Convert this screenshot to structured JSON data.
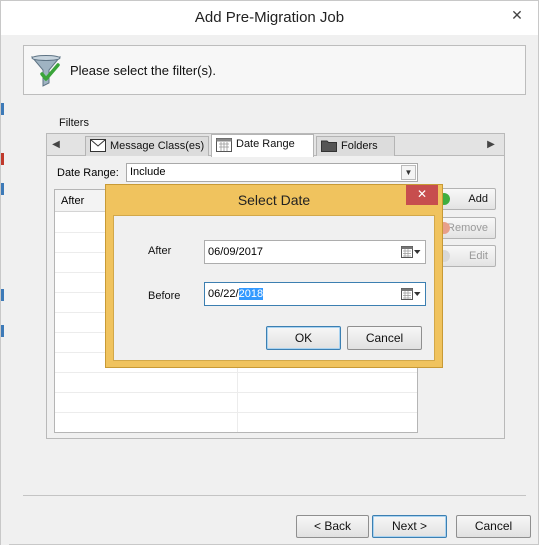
{
  "window": {
    "title": "Add Pre-Migration Job",
    "close_glyph": "✕"
  },
  "header": {
    "icon": "filter-icon",
    "text": "Please select the filter(s)."
  },
  "filters": {
    "group_label": "Filters",
    "tabs": [
      {
        "label": "Message Class(es)",
        "icon": "envelope-icon",
        "active": false
      },
      {
        "label": "Date Range",
        "icon": "calendar-icon",
        "active": true
      },
      {
        "label": "Folders",
        "icon": "folder-icon",
        "active": false
      }
    ],
    "date_range_label": "Date Range:",
    "date_range_value": "Include",
    "grid_column": "After",
    "side_buttons": {
      "add": "Add",
      "remove": "Remove",
      "edit": "Edit"
    }
  },
  "dialog": {
    "title": "Select Date",
    "close_glyph": "✕",
    "after_label": "After",
    "after_value": "06/09/2017",
    "before_label": "Before",
    "before_prefix": "06/22/",
    "before_selected": "2018",
    "ok": "OK",
    "cancel": "Cancel"
  },
  "footer": {
    "back": "< Back",
    "next": "Next >",
    "cancel": "Cancel"
  },
  "colors": {
    "dialog_frame": "#f0c35e",
    "dialog_close": "#c74e4e",
    "selection": "#3399ff",
    "default_button_border": "#3c7fb1"
  }
}
